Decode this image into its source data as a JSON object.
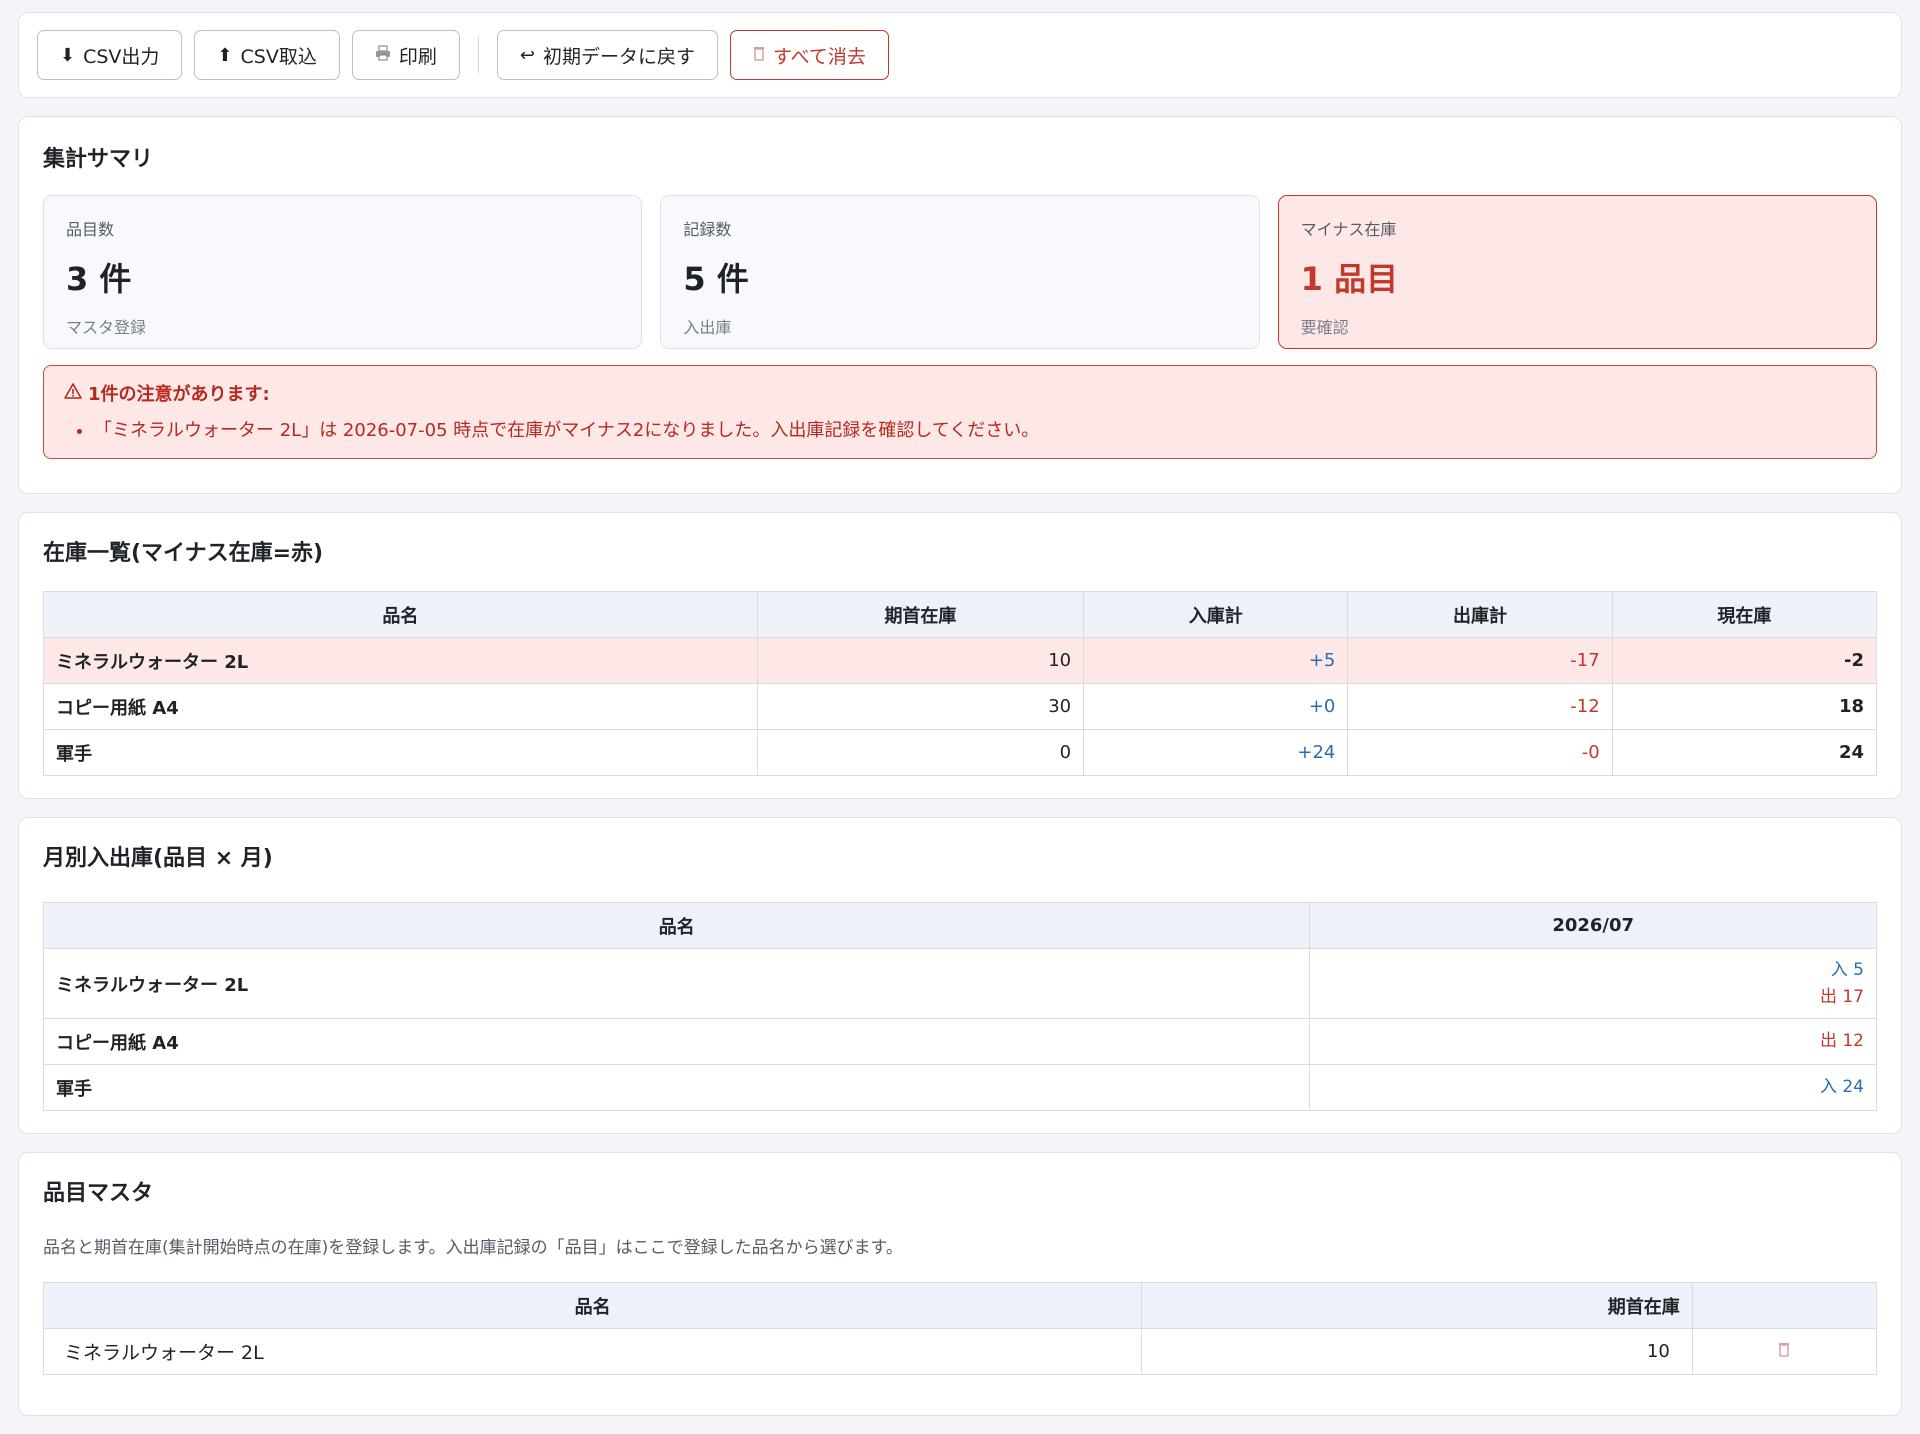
{
  "toolbar": {
    "csv_export": "CSV出力",
    "csv_import": "CSV取込",
    "print": "印刷",
    "reset": "初期データに戻す",
    "clear_all": "すべて消去"
  },
  "summary": {
    "title": "集計サマリ",
    "cards": [
      {
        "label": "品目数",
        "value": "3 件",
        "sub": "マスタ登録"
      },
      {
        "label": "記録数",
        "value": "5 件",
        "sub": "入出庫"
      },
      {
        "label": "マイナス在庫",
        "value": "1 品目",
        "sub": "要確認"
      }
    ],
    "warning_title": "1件の注意があります:",
    "warnings": [
      "「ミネラルウォーター 2L」は 2026-07-05 時点で在庫がマイナス2になりました。入出庫記録を確認してください。"
    ]
  },
  "stock": {
    "title": "在庫一覧(マイナス在庫=赤)",
    "headers": [
      "品名",
      "期首在庫",
      "入庫計",
      "出庫計",
      "現在庫"
    ],
    "rows": [
      {
        "name": "ミネラルウォーター 2L",
        "opening": "10",
        "in": "+5",
        "out": "-17",
        "current": "-2"
      },
      {
        "name": "コピー用紙 A4",
        "opening": "30",
        "in": "+0",
        "out": "-12",
        "current": "18"
      },
      {
        "name": "軍手",
        "opening": "0",
        "in": "+24",
        "out": "-0",
        "current": "24"
      }
    ]
  },
  "monthly": {
    "title": "月別入出庫(品目 × 月)",
    "headers": [
      "品名",
      "2026/07"
    ],
    "rows": [
      {
        "name": "ミネラルウォーター 2L",
        "in": "入 5",
        "out": "出 17"
      },
      {
        "name": "コピー用紙 A4",
        "in": "",
        "out": "出 12"
      },
      {
        "name": "軍手",
        "in": "入 24",
        "out": ""
      }
    ]
  },
  "master": {
    "title": "品目マスタ",
    "description": "品名と期首在庫(集計開始時点の在庫)を登録します。入出庫記録の「品目」はここで登録した品名から選びます。",
    "headers": [
      "品名",
      "期首在庫",
      ""
    ],
    "rows": [
      {
        "name": "ミネラルウォーター 2L",
        "opening": "10"
      }
    ]
  }
}
